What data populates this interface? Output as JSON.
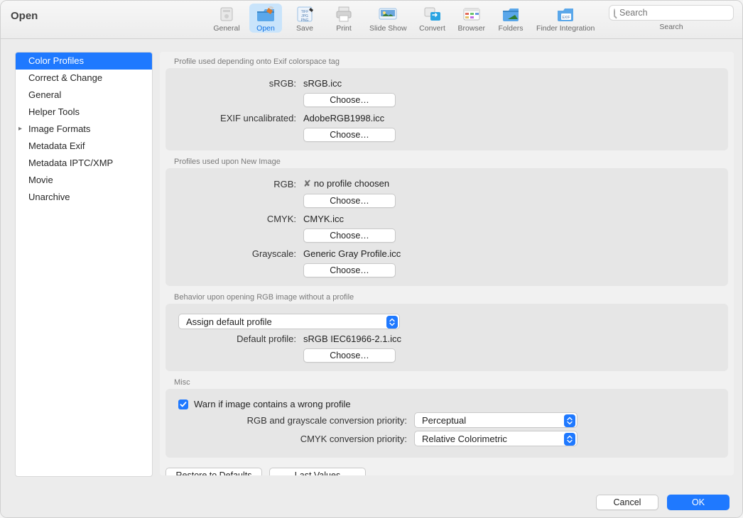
{
  "title": "Open",
  "toolbar": [
    {
      "id": "general",
      "label": "General",
      "sel": false
    },
    {
      "id": "open",
      "label": "Open",
      "sel": true
    },
    {
      "id": "save",
      "label": "Save",
      "sel": false
    },
    {
      "id": "print",
      "label": "Print",
      "sel": false
    },
    {
      "id": "slideshow",
      "label": "Slide Show",
      "sel": false
    },
    {
      "id": "convert",
      "label": "Convert",
      "sel": false
    },
    {
      "id": "browser",
      "label": "Browser",
      "sel": false
    },
    {
      "id": "folders",
      "label": "Folders",
      "sel": false
    },
    {
      "id": "finder",
      "label": "Finder Integration",
      "sel": false
    }
  ],
  "search": {
    "placeholder": "Search",
    "under": "Search"
  },
  "sidebar": [
    {
      "label": "Color Profiles",
      "sel": true,
      "expand": false
    },
    {
      "label": "Correct & Change",
      "sel": false,
      "expand": false
    },
    {
      "label": "General",
      "sel": false,
      "expand": false
    },
    {
      "label": "Helper Tools",
      "sel": false,
      "expand": false
    },
    {
      "label": "Image Formats",
      "sel": false,
      "expand": true
    },
    {
      "label": "Metadata Exif",
      "sel": false,
      "expand": false
    },
    {
      "label": "Metadata IPTC/XMP",
      "sel": false,
      "expand": false
    },
    {
      "label": "Movie",
      "sel": false,
      "expand": false
    },
    {
      "label": "Unarchive",
      "sel": false,
      "expand": false
    }
  ],
  "sections": {
    "exif": {
      "title": "Profile used depending onto Exif colorspace tag",
      "srgb_label": "sRGB:",
      "srgb_value": "sRGB.icc",
      "uncal_label": "EXIF uncalibrated:",
      "uncal_value": "AdobeRGB1998.icc",
      "choose": "Choose…"
    },
    "newimg": {
      "title": "Profiles used upon New Image",
      "rgb_label": "RGB:",
      "rgb_value": "no profile choosen",
      "rgb_none": "✘",
      "cmyk_label": "CMYK:",
      "cmyk_value": "CMYK.icc",
      "gray_label": "Grayscale:",
      "gray_value": "Generic Gray Profile.icc",
      "choose": "Choose…"
    },
    "behavior": {
      "title": "Behavior upon opening RGB image without a profile",
      "popup": "Assign default profile",
      "default_label": "Default profile:",
      "default_value": "sRGB IEC61966-2.1.icc",
      "choose": "Choose…"
    },
    "misc": {
      "title": "Misc",
      "warn": "Warn if image contains a wrong profile",
      "rgb_priority_label": "RGB and grayscale conversion priority:",
      "rgb_priority_value": "Perceptual",
      "cmyk_priority_label": "CMYK conversion priority:",
      "cmyk_priority_value": "Relative Colorimetric"
    }
  },
  "bottom": {
    "restore": "Restore to Defaults",
    "last": "Last Values"
  },
  "footer": {
    "cancel": "Cancel",
    "ok": "OK"
  }
}
